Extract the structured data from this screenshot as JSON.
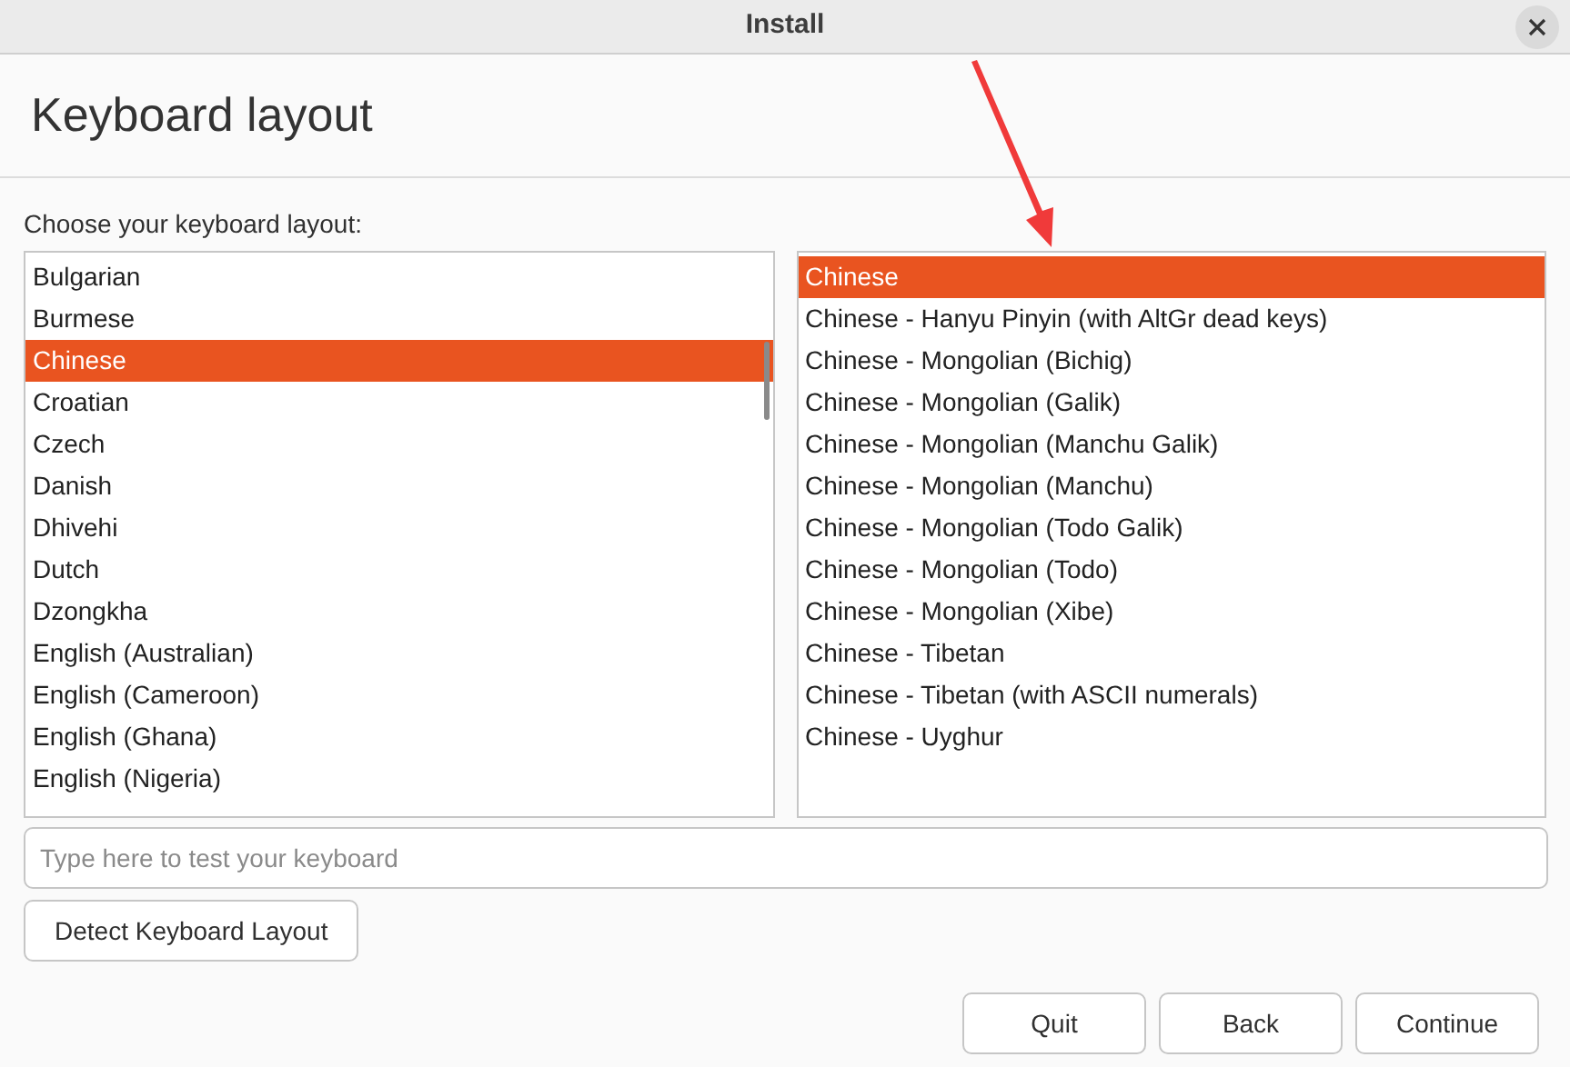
{
  "window": {
    "title": "Install"
  },
  "heading": "Keyboard layout",
  "prompt": "Choose your keyboard layout:",
  "layouts": [
    {
      "label": "Bulgarian",
      "selected": false
    },
    {
      "label": "Burmese",
      "selected": false
    },
    {
      "label": "Chinese",
      "selected": true
    },
    {
      "label": "Croatian",
      "selected": false
    },
    {
      "label": "Czech",
      "selected": false
    },
    {
      "label": "Danish",
      "selected": false
    },
    {
      "label": "Dhivehi",
      "selected": false
    },
    {
      "label": "Dutch",
      "selected": false
    },
    {
      "label": "Dzongkha",
      "selected": false
    },
    {
      "label": "English (Australian)",
      "selected": false
    },
    {
      "label": "English (Cameroon)",
      "selected": false
    },
    {
      "label": "English (Ghana)",
      "selected": false
    },
    {
      "label": "English (Nigeria)",
      "selected": false
    }
  ],
  "variants": [
    {
      "label": "Chinese",
      "selected": true
    },
    {
      "label": "Chinese - Hanyu Pinyin (with AltGr dead keys)",
      "selected": false
    },
    {
      "label": "Chinese - Mongolian (Bichig)",
      "selected": false
    },
    {
      "label": "Chinese - Mongolian (Galik)",
      "selected": false
    },
    {
      "label": "Chinese - Mongolian (Manchu Galik)",
      "selected": false
    },
    {
      "label": "Chinese - Mongolian (Manchu)",
      "selected": false
    },
    {
      "label": "Chinese - Mongolian (Todo Galik)",
      "selected": false
    },
    {
      "label": "Chinese - Mongolian (Todo)",
      "selected": false
    },
    {
      "label": "Chinese - Mongolian (Xibe)",
      "selected": false
    },
    {
      "label": "Chinese - Tibetan",
      "selected": false
    },
    {
      "label": "Chinese - Tibetan (with ASCII numerals)",
      "selected": false
    },
    {
      "label": "Chinese - Uyghur",
      "selected": false
    }
  ],
  "test_field": {
    "placeholder": "Type here to test your keyboard"
  },
  "detect_button": "Detect Keyboard Layout",
  "buttons": [
    "Quit",
    "Back",
    "Continue"
  ]
}
